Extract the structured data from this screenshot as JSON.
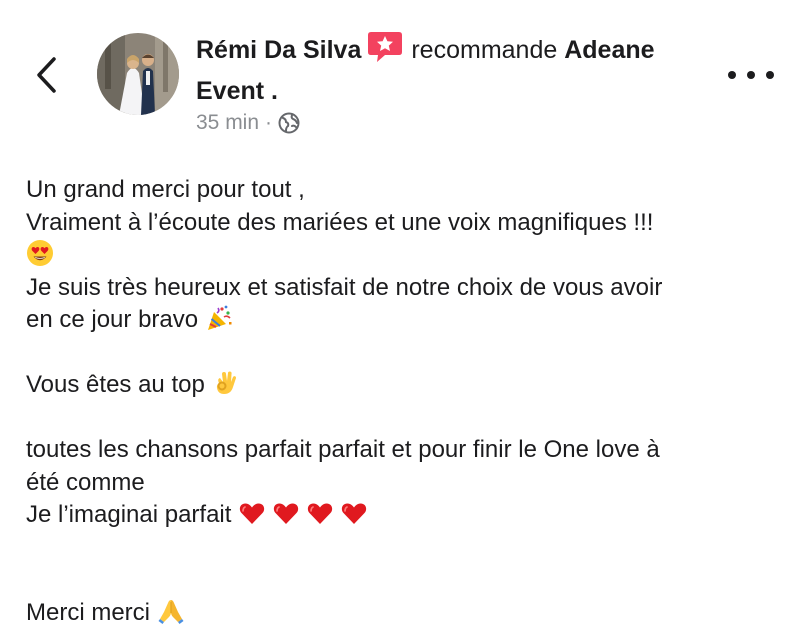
{
  "header": {
    "author_name": "Rémi Da Silva",
    "action_text": "recommande",
    "page_name_line1": "Adeane",
    "page_name_line2": "Event .",
    "time": "35 min",
    "separator": "·",
    "audience_icon": "globe-icon",
    "back_icon": "chevron-left-icon",
    "more_icon": "more-horizontal-icon",
    "recommend_icon": "recommend-star-icon"
  },
  "post": {
    "line1": "Un grand merci pour tout ,",
    "line2": "Vraiment à l’écoute des mariées et une voix magnifiques !!!",
    "line4": "Je suis très heureux et satisfait de notre choix de vous avoir",
    "line5": "en ce jour bravo",
    "line7": "Vous êtes au top",
    "line9": "toutes les chansons parfait parfait et pour finir le One love à",
    "line10": "été comme",
    "line11": "Je l’imaginai parfait",
    "line14": "Merci merci"
  },
  "colors": {
    "text": "#1c1c1e",
    "meta": "#8a8d91",
    "recommend_badge": "#f3425f",
    "heart": "#e0191f"
  }
}
